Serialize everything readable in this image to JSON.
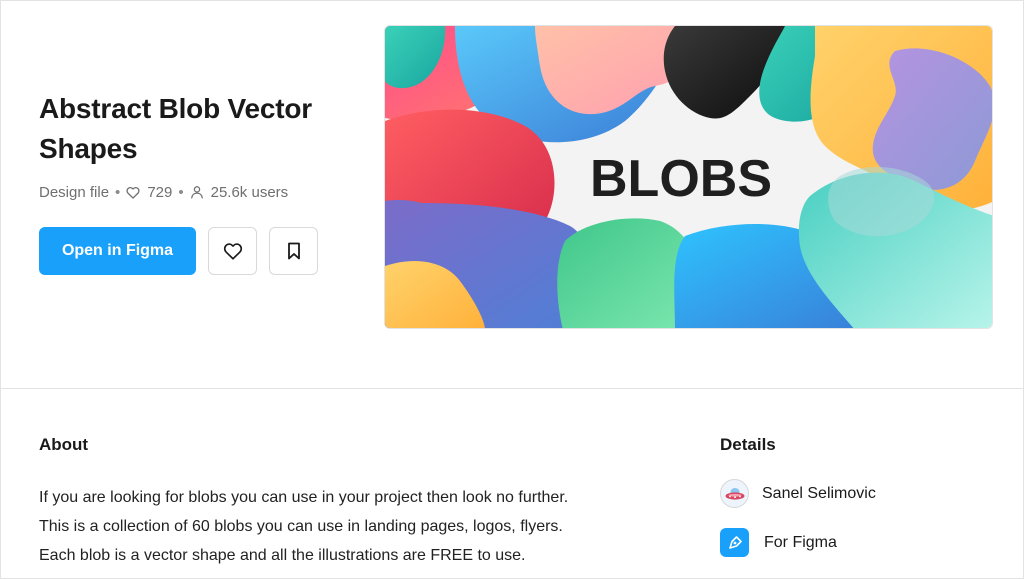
{
  "file": {
    "title": "Abstract Blob Vector Shapes",
    "type": "Design file",
    "likes": "729",
    "users": "25.6k users",
    "separator": "•"
  },
  "actions": {
    "open_label": "Open in Figma",
    "like_icon": "heart-icon",
    "save_icon": "bookmark-icon"
  },
  "cover": {
    "text": "BLOBS"
  },
  "about": {
    "heading": "About",
    "lines": [
      "If you are looking for blobs you can use in your project then look no further.",
      "This is a collection of 60 blobs you can use in landing pages, logos, flyers.",
      "Each blob is a vector shape and all the illustrations are FREE to use."
    ]
  },
  "details": {
    "heading": "Details",
    "author": "Sanel Selimovic",
    "platform": "For Figma"
  },
  "colors": {
    "accent": "#18a0fb",
    "text": "#1a1a1a",
    "muted": "#6f6f6f",
    "border": "#e3e3e3"
  }
}
